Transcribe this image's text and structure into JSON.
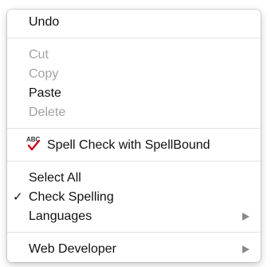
{
  "menu": {
    "undo": "Undo",
    "cut": "Cut",
    "copy": "Copy",
    "paste": "Paste",
    "delete": "Delete",
    "spellbound": {
      "icon_text": "ABC",
      "label": "Spell Check with SpellBound",
      "check_color": "#d0021b"
    },
    "select_all": "Select All",
    "check_spelling": {
      "checkmark": "✓",
      "label": "Check Spelling"
    },
    "languages": "Languages",
    "web_developer": "Web Developer"
  },
  "colors": {
    "disabled_text": "#a3a3a3",
    "enabled_text": "#111111",
    "separator": "#e3e3e3",
    "submenu_arrow": "#8a8a8a"
  },
  "icons": {
    "spellbound": "abc-check-icon",
    "submenu": "submenu-arrow-icon",
    "checked": "checkmark-icon"
  }
}
